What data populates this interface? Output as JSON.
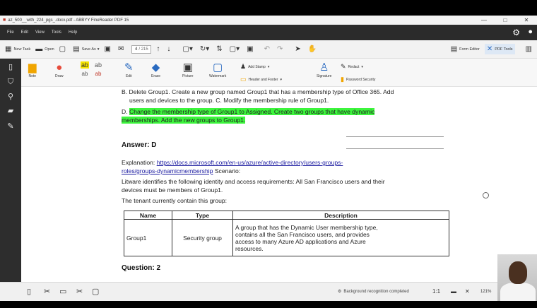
{
  "window": {
    "title": "az_500__with_224_pgs_.docx.pdf - ABBYY FineReader PDF 15",
    "controls": [
      "—",
      "□",
      "✕"
    ]
  },
  "menu": {
    "items": [
      "File",
      "Edit",
      "View",
      "Tools",
      "Help"
    ]
  },
  "toolbar": {
    "new_task": "New Task",
    "open": "Open",
    "save_as": "Save As",
    "page_current": "4",
    "page_total": "/ 215",
    "form_editor": "Form Editor",
    "pdf_tools": "PDF Tools"
  },
  "ribbon": {
    "note": "Note",
    "draw": "Draw",
    "edit": "Edit",
    "erase": "Erase",
    "picture": "Picture",
    "watermark": "Watermark",
    "add_stamp": "Add Stamp",
    "header_footer": "Header and Footer",
    "signature": "Signature",
    "redact": "Redact",
    "password_security": "Password Security"
  },
  "document": {
    "option_b_line1": "B. Delete Group1. Create a new group named Group1 that has a membership type of Office 365. Add",
    "option_b_line2": "users and devices to the group. C. Modify the membership rule of Group1.",
    "option_d_prefix": "D. ",
    "option_d_hl1": "Change the membership type of Group1 to Assigned. Create two groups that have dynamic",
    "option_d_hl2": "memberships. Add the new groups to Group1.",
    "answer": "Answer: D",
    "explanation_prefix": "Explanation: ",
    "explanation_link1": "https://docs.microsoft.com/en-us/azure/active-directory/users-groups-",
    "explanation_link2": "roles/groups-dynamicmembership",
    "explanation_suffix": " Scenario:",
    "litware_line1": "Litware identifies the following identity and access requirements: All San Francisco users and their",
    "litware_line2": "devices must be members of Group1.",
    "tenant_line": "The tenant currently contain this group:",
    "table": {
      "headers": [
        "Name",
        "Type",
        "Description"
      ],
      "row": {
        "name": "Group1",
        "type": "Security group",
        "desc1": "A group that has the Dynamic User membership type,",
        "desc2": "contains all the San Francisco users, and provides",
        "desc3": "access to many Azure AD applications and Azure",
        "desc4": "resources."
      }
    },
    "question_heading": "Question: 2"
  },
  "status": {
    "message": "Background recognition completed",
    "zoom_ratio": "1:1",
    "zoom_percent": "121%"
  },
  "icons": [
    "new-task-icon",
    "open-icon",
    "save-icon",
    "print-icon",
    "email-icon",
    "note-icon",
    "draw-icon",
    "edit-icon",
    "erase-icon",
    "picture-icon",
    "watermark-icon",
    "stamp-icon",
    "signature-icon",
    "redact-icon",
    "lock-icon",
    "search-icon",
    "bookmark-icon",
    "gear-icon"
  ]
}
